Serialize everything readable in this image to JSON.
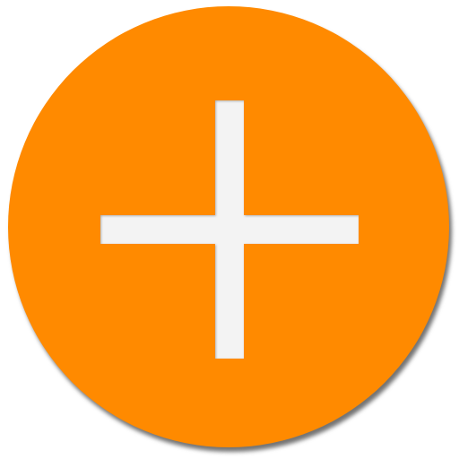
{
  "add_button": {
    "icon": "plus-icon",
    "background_color": "#FF8A00",
    "icon_color": "#F3F3F3"
  }
}
